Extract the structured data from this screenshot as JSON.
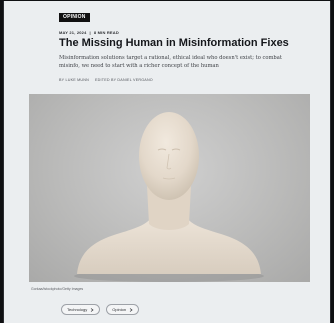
{
  "article": {
    "kicker": "OPINION",
    "date": "MAY 21, 2024",
    "separator": "|",
    "read_time": "8 MIN READ",
    "title": "The Missing Human in Misinformation Fixes",
    "dek": "Misinformation solutions target a rational, ethical ideal who doesn't exist; to combat misinfo, we need to start with a richer concept of the human",
    "byline": {
      "author": "BY LUKE MUNN",
      "editor": "EDITED BY DANIEL VERGANO"
    },
    "image": {
      "subject": "pale featureless mannequin bust",
      "credit": "Gorkaa/Istockphoto/Getty Images"
    },
    "tags": [
      {
        "label": "Technology",
        "icon": "chevron-right-icon"
      },
      {
        "label": "Opinion",
        "icon": "chevron-right-icon"
      }
    ]
  }
}
